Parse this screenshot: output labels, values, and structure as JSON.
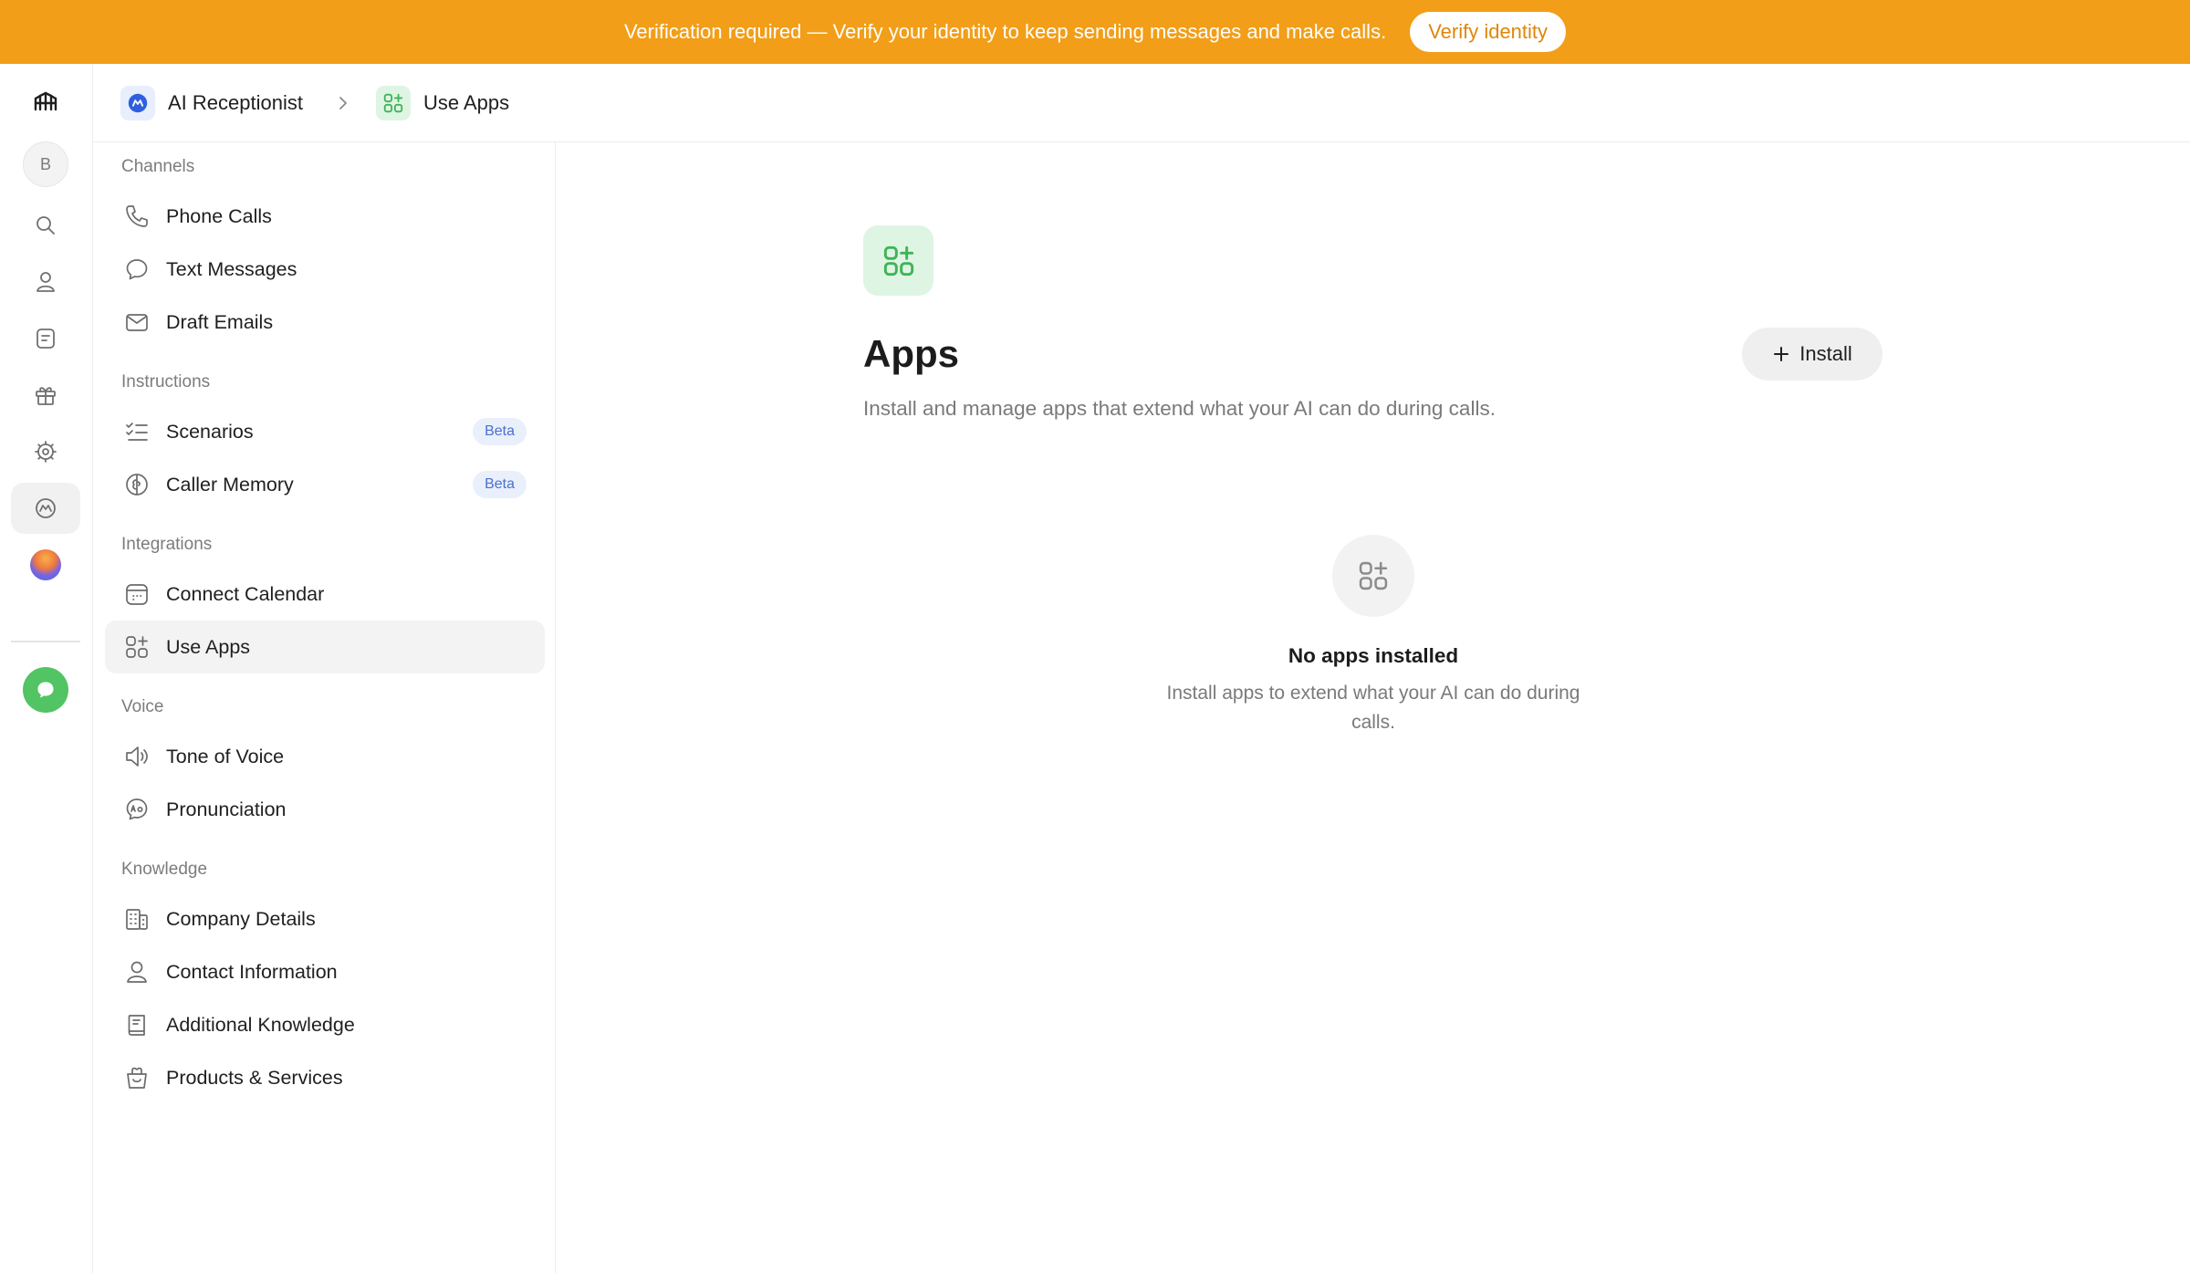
{
  "banner": {
    "text": "Verification required — Verify your identity to keep sending messages and make calls.",
    "button_label": "Verify identity",
    "color": "#f29e18"
  },
  "rail": {
    "avatar_initial": "B",
    "icons": [
      "logo-icon",
      "search-icon",
      "user-icon",
      "note-icon",
      "gift-icon",
      "settings-icon",
      "ai-receptionist-icon",
      "orb-icon",
      "chat-icon"
    ]
  },
  "breadcrumb": {
    "items": [
      {
        "label": "AI Receptionist",
        "icon": "ai-receptionist-icon"
      },
      {
        "label": "Use Apps",
        "icon": "apps-icon"
      }
    ]
  },
  "sidebar": {
    "sections": [
      {
        "title": "Channels",
        "items": [
          {
            "label": "Phone Calls",
            "icon": "phone-icon"
          },
          {
            "label": "Text Messages",
            "icon": "message-icon"
          },
          {
            "label": "Draft Emails",
            "icon": "mail-icon"
          }
        ]
      },
      {
        "title": "Instructions",
        "items": [
          {
            "label": "Scenarios",
            "icon": "list-check-icon",
            "badge": "Beta"
          },
          {
            "label": "Caller Memory",
            "icon": "brain-icon",
            "badge": "Beta"
          }
        ]
      },
      {
        "title": "Integrations",
        "items": [
          {
            "label": "Connect Calendar",
            "icon": "calendar-icon"
          },
          {
            "label": "Use Apps",
            "icon": "apps-icon",
            "active": true
          }
        ]
      },
      {
        "title": "Voice",
        "items": [
          {
            "label": "Tone of Voice",
            "icon": "speaker-icon"
          },
          {
            "label": "Pronunciation",
            "icon": "pronunciation-icon"
          }
        ]
      },
      {
        "title": "Knowledge",
        "items": [
          {
            "label": "Company Details",
            "icon": "building-icon"
          },
          {
            "label": "Contact Information",
            "icon": "person-icon"
          },
          {
            "label": "Additional Knowledge",
            "icon": "book-icon"
          },
          {
            "label": "Products & Services",
            "icon": "box-icon"
          }
        ]
      }
    ]
  },
  "main": {
    "title": "Apps",
    "subtitle": "Install and manage apps that extend what your AI can do during calls.",
    "install_label": "Install",
    "empty_title": "No apps installed",
    "empty_text": "Install apps to extend what your AI can do during calls."
  },
  "colors": {
    "accent_green": "#52c463",
    "beta_text": "#4a6fce",
    "beta_bg": "#e9effb"
  }
}
